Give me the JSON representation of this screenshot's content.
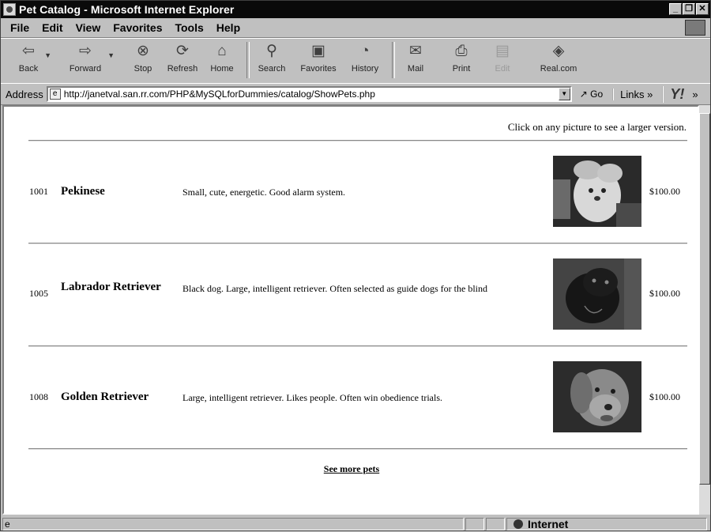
{
  "window": {
    "title": "Pet Catalog - Microsoft Internet Explorer"
  },
  "menu": [
    {
      "label": "File"
    },
    {
      "label": "Edit"
    },
    {
      "label": "View"
    },
    {
      "label": "Favorites"
    },
    {
      "label": "Tools"
    },
    {
      "label": "Help"
    }
  ],
  "toolbar": {
    "back": "Back",
    "forward": "Forward",
    "stop": "Stop",
    "refresh": "Refresh",
    "home": "Home",
    "search": "Search",
    "favorites": "Favorites",
    "history": "History",
    "mail": "Mail",
    "print": "Print",
    "edit": "Edit",
    "real": "Real.com"
  },
  "address": {
    "label": "Address",
    "url": "http://janetval.san.rr.com/PHP&MySQLforDummies/catalog/ShowPets.php",
    "go": "Go",
    "links": "Links »"
  },
  "page": {
    "hint": "Click on any picture to see a larger version.",
    "pets": [
      {
        "id": "1001",
        "name": "Pekinese",
        "description": "Small, cute, energetic. Good alarm system.",
        "price": "$100.00"
      },
      {
        "id": "1005",
        "name": "Labrador Retriever",
        "description": "Black dog. Large, intelligent retriever. Often selected as guide dogs for the blind",
        "price": "$100.00"
      },
      {
        "id": "1008",
        "name": "Golden Retriever",
        "description": "Large, intelligent retriever. Likes people. Often win obedience trials.",
        "price": "$100.00"
      }
    ],
    "more_link": "See more pets"
  },
  "status": {
    "zone": "Internet"
  }
}
